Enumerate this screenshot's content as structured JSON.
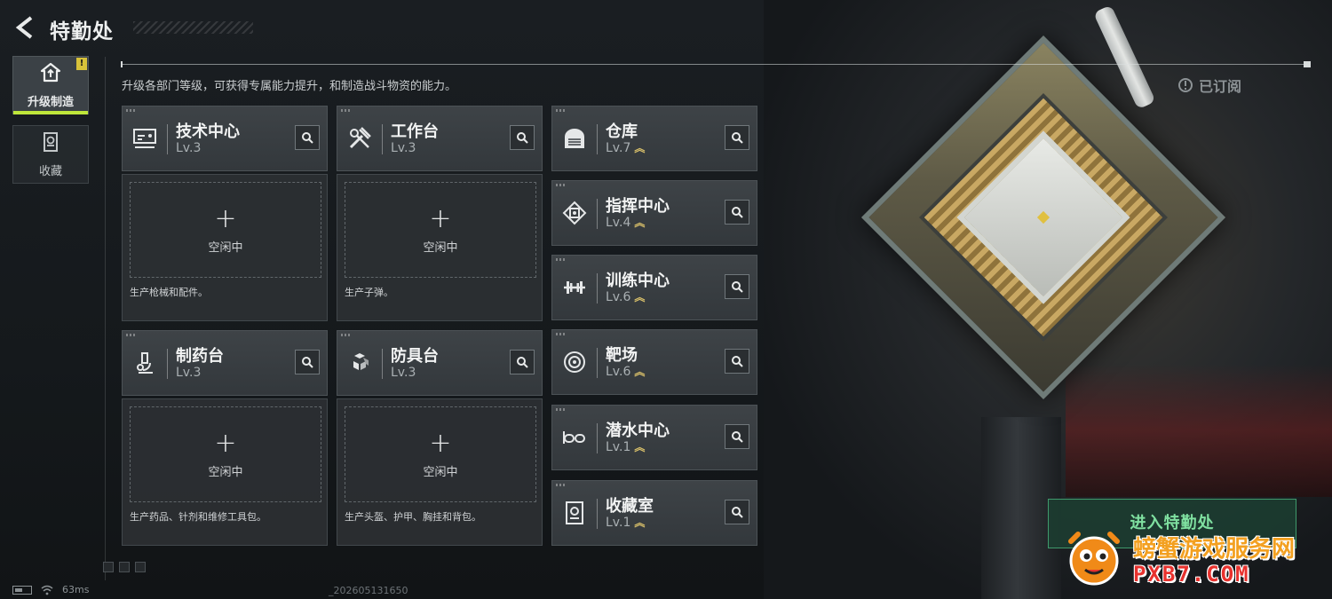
{
  "header": {
    "title": "特勤处",
    "subtitle": "升级各部门等级，可获得专属能力提升，和制造战斗物资的能力。",
    "subscribed_label": "已订阅"
  },
  "sidebar": {
    "items": [
      {
        "label": "升级制造",
        "icon": "upgrade-icon",
        "active": true,
        "badge": "!"
      },
      {
        "label": "收藏",
        "icon": "collection-icon",
        "active": false
      }
    ]
  },
  "production_cards": [
    {
      "name": "技术中心",
      "level": "Lv.3",
      "icon": "computer-icon",
      "idle_label": "空闲中",
      "desc": "生产枪械和配件。"
    },
    {
      "name": "工作台",
      "level": "Lv.3",
      "icon": "tools-icon",
      "idle_label": "空闲中",
      "desc": "生产子弹。"
    },
    {
      "name": "制药台",
      "level": "Lv.3",
      "icon": "microscope-icon",
      "idle_label": "空闲中",
      "desc": "生产药品、针剂和维修工具包。"
    },
    {
      "name": "防具台",
      "level": "Lv.3",
      "icon": "cubes-icon",
      "idle_label": "空闲中",
      "desc": "生产头盔、护甲、胸挂和背包。"
    }
  ],
  "facilities": [
    {
      "name": "仓库",
      "level": "Lv.7",
      "icon": "warehouse-icon",
      "upgradable": true
    },
    {
      "name": "指挥中心",
      "level": "Lv.4",
      "icon": "chip-icon",
      "upgradable": true
    },
    {
      "name": "训练中心",
      "level": "Lv.6",
      "icon": "dumbbell-icon",
      "upgradable": true
    },
    {
      "name": "靶场",
      "level": "Lv.6",
      "icon": "target-icon",
      "upgradable": true
    },
    {
      "name": "潜水中心",
      "level": "Lv.1",
      "icon": "diving-mask-icon",
      "upgradable": true
    },
    {
      "name": "收藏室",
      "level": "Lv.1",
      "icon": "vault-icon",
      "upgradable": true
    }
  ],
  "enter_button": {
    "label": "进入特勤处"
  },
  "watermark": {
    "line1": "螃蟹游戏服务网",
    "line2": "PXB7.COM"
  },
  "status": {
    "ping": "63ms",
    "build": "_202605131650"
  },
  "colors": {
    "accent": "#bfe63a",
    "upgrade_arrow": "#d9c06a",
    "enter_green": "#7fe0a0",
    "badge": "#d8c23a"
  }
}
